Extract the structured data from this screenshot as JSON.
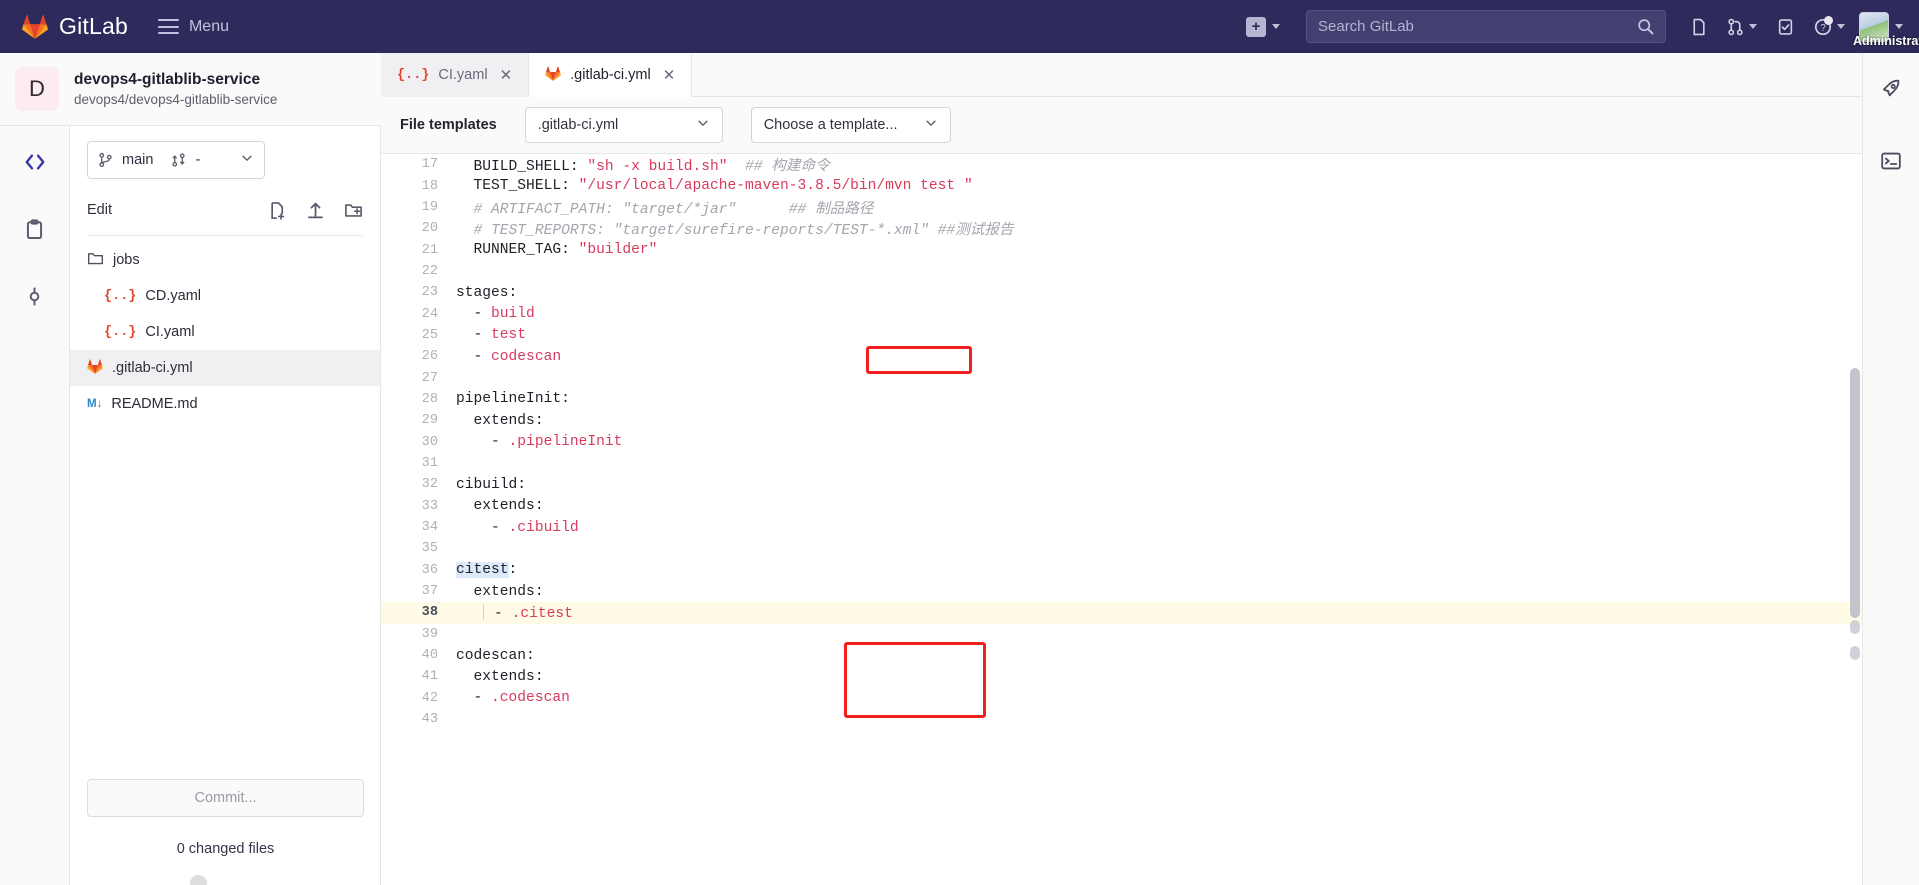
{
  "navbar": {
    "brand": "GitLab",
    "menu_label": "Menu",
    "logo_icon": "gitlab-fox-icon",
    "hamburger_icon": "hamburger-icon",
    "plus_icon": "plus-square-icon",
    "search_placeholder": "Search GitLab",
    "search_value": "",
    "search_icon": "search-icon",
    "icons": [
      {
        "name": "issues-icon",
        "glyph": "issues"
      },
      {
        "name": "merge-requests-icon",
        "glyph": "merge"
      },
      {
        "name": "todos-icon",
        "glyph": "todo"
      },
      {
        "name": "help-icon",
        "glyph": "help"
      }
    ],
    "user_name": "Administrato",
    "avatar_icon": "user-avatar"
  },
  "project": {
    "initial": "D",
    "name": "devops4-gitlablib-service",
    "path": "devops4/devops4-gitlablib-service"
  },
  "rail": {
    "items": [
      {
        "name": "sidebar-item-edit",
        "icon": "code-brackets-icon",
        "active": true
      },
      {
        "name": "sidebar-item-review",
        "icon": "clipboard-icon",
        "active": false
      },
      {
        "name": "sidebar-item-commit",
        "icon": "commit-icon",
        "active": false
      }
    ]
  },
  "left_panel": {
    "branch": "main",
    "branch_icon": "branch-icon",
    "mr_icon": "merge-request-icon",
    "mr_value": "-",
    "edit_label": "Edit",
    "actions": [
      {
        "name": "new-file-button",
        "icon": "new-file-icon"
      },
      {
        "name": "upload-file-button",
        "icon": "upload-icon"
      },
      {
        "name": "new-directory-button",
        "icon": "new-folder-icon"
      }
    ],
    "tree": [
      {
        "name": "jobs",
        "type": "folder",
        "icon": "folder-icon",
        "depth": 0,
        "selected": false
      },
      {
        "name": "CD.yaml",
        "type": "yaml",
        "icon": "yaml-file-icon",
        "depth": 1,
        "selected": false
      },
      {
        "name": "CI.yaml",
        "type": "yaml",
        "icon": "yaml-file-icon",
        "depth": 1,
        "selected": false
      },
      {
        "name": ".gitlab-ci.yml",
        "type": "gitlab",
        "icon": "gitlab-file-icon",
        "depth": 0,
        "selected": true
      },
      {
        "name": "README.md",
        "type": "markdown",
        "icon": "markdown-file-icon",
        "depth": 0,
        "selected": false
      }
    ],
    "commit_button": "Commit...",
    "changed_files": "0 changed files"
  },
  "editor": {
    "tabs": [
      {
        "label": "CI.yaml",
        "icon": "yaml-file-icon",
        "active": false,
        "close_icon": "close-icon"
      },
      {
        "label": ".gitlab-ci.yml",
        "icon": "gitlab-file-icon",
        "active": true,
        "close_icon": "close-icon"
      }
    ],
    "templates": {
      "label": "File templates",
      "file_type": ".gitlab-ci.yml",
      "choose": "Choose a template...",
      "caret_icon": "chevron-down-icon"
    },
    "first_line_number": 17,
    "current_line": 38,
    "lines": [
      {
        "n": 17,
        "segments": [
          {
            "t": "  BUILD_SHELL: ",
            "c": "tk-key"
          },
          {
            "t": "\"sh -x build.sh\"",
            "c": "tk-str"
          },
          {
            "t": "  ## 构建命令",
            "c": "tk-cmt"
          }
        ]
      },
      {
        "n": 18,
        "segments": [
          {
            "t": "  TEST_SHELL: ",
            "c": "tk-key"
          },
          {
            "t": "\"/usr/local/apache-maven-3.8.5/bin/mvn test \"",
            "c": "tk-str"
          }
        ]
      },
      {
        "n": 19,
        "segments": [
          {
            "t": "  # ARTIFACT_PATH: \"target/*jar\"      ## 制品路径",
            "c": "tk-cmt"
          }
        ]
      },
      {
        "n": 20,
        "segments": [
          {
            "t": "  # TEST_REPORTS: \"target/surefire-reports/TEST-*.xml\" ##测试报告",
            "c": "tk-cmt"
          }
        ]
      },
      {
        "n": 21,
        "segments": [
          {
            "t": "  RUNNER_TAG: ",
            "c": "tk-key"
          },
          {
            "t": "\"builder\"",
            "c": "tk-str"
          }
        ]
      },
      {
        "n": 22,
        "segments": []
      },
      {
        "n": 23,
        "segments": [
          {
            "t": "stages:",
            "c": "tk-key"
          }
        ]
      },
      {
        "n": 24,
        "segments": [
          {
            "t": "  - ",
            "c": "tk-key"
          },
          {
            "t": "build",
            "c": "tk-val"
          }
        ]
      },
      {
        "n": 25,
        "segments": [
          {
            "t": "  - ",
            "c": "tk-key"
          },
          {
            "t": "test",
            "c": "tk-val"
          }
        ]
      },
      {
        "n": 26,
        "segments": [
          {
            "t": "  - ",
            "c": "tk-key"
          },
          {
            "t": "codescan",
            "c": "tk-val"
          }
        ]
      },
      {
        "n": 27,
        "segments": []
      },
      {
        "n": 28,
        "segments": [
          {
            "t": "pipelineInit:",
            "c": "tk-key"
          }
        ]
      },
      {
        "n": 29,
        "segments": [
          {
            "t": "  extends:",
            "c": "tk-key"
          }
        ]
      },
      {
        "n": 30,
        "segments": [
          {
            "t": "    - ",
            "c": "tk-key"
          },
          {
            "t": ".pipelineInit",
            "c": "tk-val"
          }
        ]
      },
      {
        "n": 31,
        "segments": []
      },
      {
        "n": 32,
        "segments": [
          {
            "t": "cibuild:",
            "c": "tk-key"
          }
        ]
      },
      {
        "n": 33,
        "segments": [
          {
            "t": "  extends:",
            "c": "tk-key"
          }
        ]
      },
      {
        "n": 34,
        "segments": [
          {
            "t": "    - ",
            "c": "tk-key"
          },
          {
            "t": ".cibuild",
            "c": "tk-val"
          }
        ]
      },
      {
        "n": 35,
        "segments": []
      },
      {
        "n": 36,
        "segments": [
          {
            "t": "citest",
            "c": "tk-key hl-word"
          },
          {
            "t": ":",
            "c": "tk-key"
          }
        ]
      },
      {
        "n": 37,
        "segments": [
          {
            "t": "  extends:",
            "c": "tk-key"
          }
        ]
      },
      {
        "n": 38,
        "segments": [
          {
            "t": "   ",
            "c": "tk-key"
          },
          {
            "t": "|",
            "c": "caret"
          },
          {
            "t": " - ",
            "c": "tk-key"
          },
          {
            "t": ".citest",
            "c": "tk-val"
          }
        ]
      },
      {
        "n": 39,
        "segments": []
      },
      {
        "n": 40,
        "segments": [
          {
            "t": "codescan:",
            "c": "tk-key"
          }
        ]
      },
      {
        "n": 41,
        "segments": [
          {
            "t": "  extends:",
            "c": "tk-key"
          }
        ]
      },
      {
        "n": 42,
        "segments": [
          {
            "t": "  - ",
            "c": "tk-key"
          },
          {
            "t": ".codescan",
            "c": "tk-val"
          }
        ]
      },
      {
        "n": 43,
        "segments": []
      }
    ],
    "annotations": [
      {
        "name": "annotation-box-codescan-stage",
        "color": "#f21f1f",
        "target_line": 26
      },
      {
        "name": "annotation-box-codescan-job",
        "color": "#f21f1f",
        "target_line": 40
      }
    ]
  },
  "right_rail": {
    "items": [
      {
        "name": "pipelines-icon",
        "icon": "rocket-icon"
      },
      {
        "name": "terminal-icon",
        "icon": "terminal-icon"
      }
    ]
  }
}
